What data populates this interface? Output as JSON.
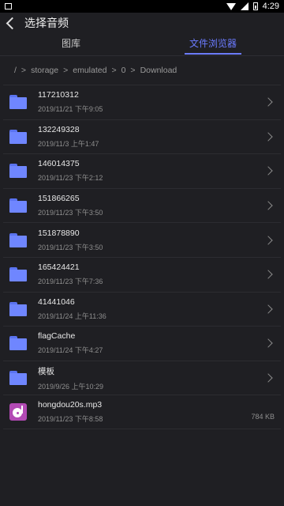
{
  "status_bar": {
    "time": "4:29"
  },
  "header": {
    "title": "选择音频"
  },
  "tabs": [
    {
      "label": "图库",
      "active": false
    },
    {
      "label": "文件浏览器",
      "active": true
    }
  ],
  "breadcrumb": [
    "/",
    ">",
    "storage",
    ">",
    "emulated",
    ">",
    "0",
    ">",
    "Download"
  ],
  "items": [
    {
      "name": "117210312",
      "meta": "2019/11/21 下午9:05",
      "type": "folder"
    },
    {
      "name": "132249328",
      "meta": "2019/11/3 上午1:47",
      "type": "folder"
    },
    {
      "name": "146014375",
      "meta": "2019/11/23 下午2:12",
      "type": "folder"
    },
    {
      "name": "151866265",
      "meta": "2019/11/23 下午3:50",
      "type": "folder"
    },
    {
      "name": "151878890",
      "meta": "2019/11/23 下午3:50",
      "type": "folder"
    },
    {
      "name": "165424421",
      "meta": "2019/11/23 下午7:36",
      "type": "folder"
    },
    {
      "name": "41441046",
      "meta": "2019/11/24 上午11:36",
      "type": "folder"
    },
    {
      "name": "flagCache",
      "meta": "2019/11/24 下午4:27",
      "type": "folder"
    },
    {
      "name": "模板",
      "meta": "2019/9/26 上午10:29",
      "type": "folder"
    },
    {
      "name": "hongdou20s.mp3",
      "meta": "2019/11/23 下午8:58",
      "type": "audio",
      "size": "784 KB"
    }
  ],
  "colors": {
    "accent": "#6b7bff",
    "folder": "#6f86ff",
    "audio": "#b24ab4",
    "background": "#1f1f23"
  },
  "icons": {
    "folder": "folder-icon",
    "audio": "audio-file-icon",
    "back": "back-arrow-icon",
    "chevron": "chevron-right-icon"
  }
}
